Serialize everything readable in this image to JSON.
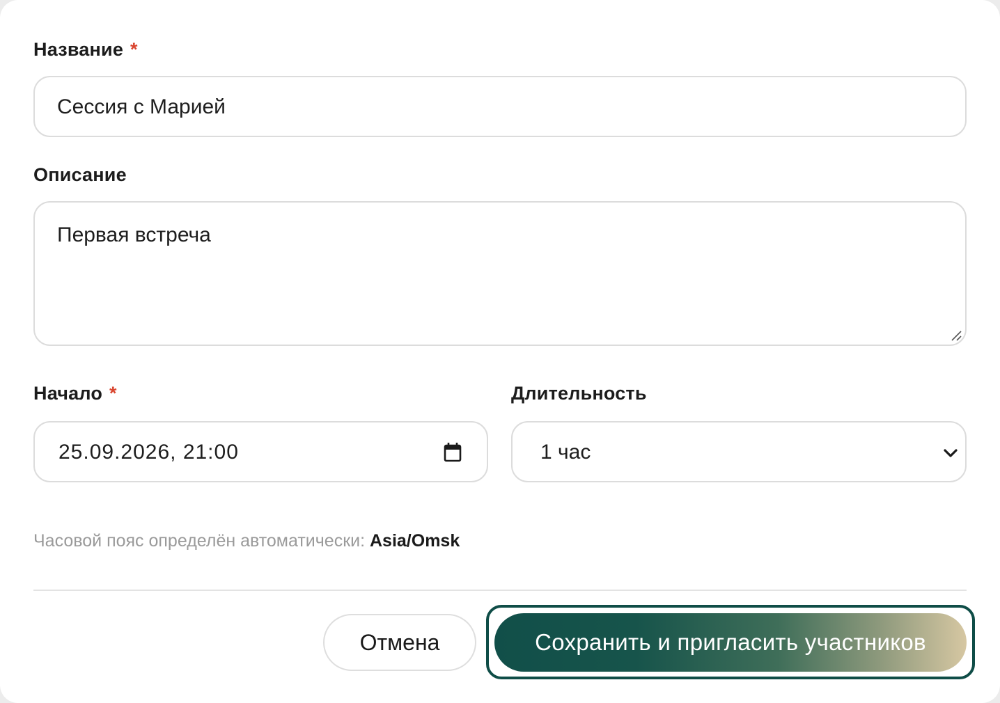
{
  "form": {
    "title_field": {
      "label": "Название",
      "required_mark": "*",
      "value": "Сессия с Марией"
    },
    "description_field": {
      "label": "Описание",
      "value": "Первая встреча"
    },
    "start_field": {
      "label": "Начало",
      "required_mark": "*",
      "value": "25.09.2026, 21:00"
    },
    "duration_field": {
      "label": "Длительность",
      "selected": "1 час"
    },
    "timezone_hint": {
      "text": "Часовой пояс определён автоматически:",
      "value": "Asia/Omsk"
    }
  },
  "actions": {
    "cancel_label": "Отмена",
    "submit_label": "Сохранить и пригласить участников"
  },
  "icons": {
    "calendar": "calendar-icon",
    "dropdown": "chevron-down-icon",
    "resize": "resize-grip-icon"
  },
  "colors": {
    "required": "#d9452f",
    "primary_start": "#114f49",
    "primary_end": "#d6c7a2"
  }
}
